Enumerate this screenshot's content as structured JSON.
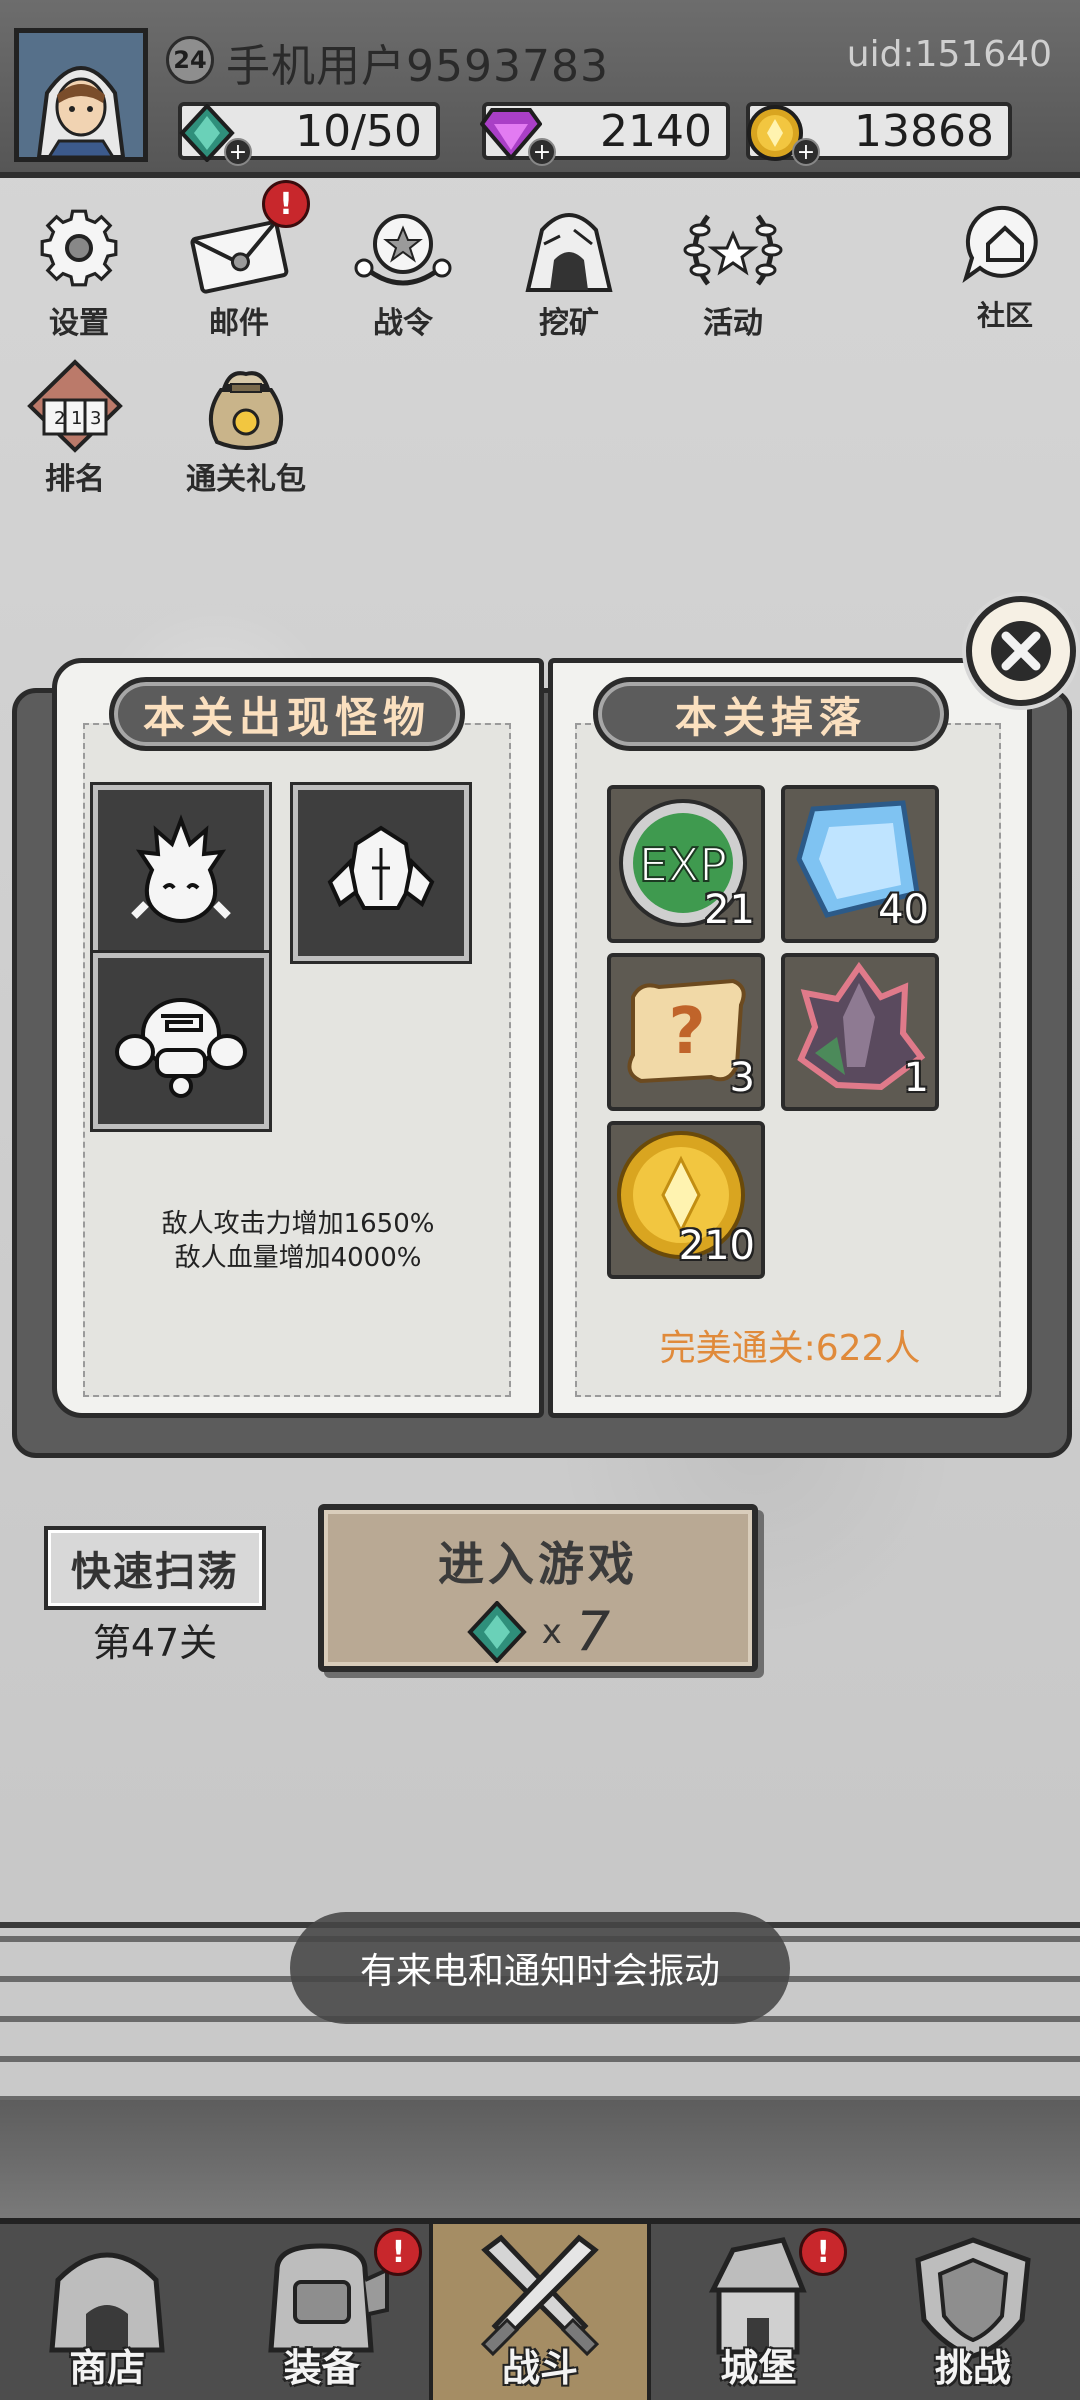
{
  "header": {
    "level": "24",
    "username": "手机用户9593783",
    "uid": "uid:151640",
    "stamina": "10/50",
    "gems": "2140",
    "coins": "13868",
    "icons": [
      "avatar-hooded-hero",
      "energy-crystal-icon",
      "purple-diamond-icon",
      "gold-coin-icon"
    ]
  },
  "menu": {
    "settings": "设置",
    "mail": "邮件",
    "battle_pass": "战令",
    "mining": "挖矿",
    "events": "活动",
    "community": "社区",
    "ranking": "排名",
    "clear_gift": "通关礼包",
    "notif_mark": "!"
  },
  "book": {
    "monsters_title": "本关出现怪物",
    "drops_title": "本关掉落",
    "monsters": [
      "flame-blob",
      "crystal-golem",
      "armored-beast"
    ],
    "buff_attack": "敌人攻击力增加1650%",
    "buff_hp": "敌人血量增加4000%",
    "drops": [
      {
        "item": "exp",
        "label": "EXP",
        "qty": "21"
      },
      {
        "item": "blue-gem",
        "qty": "40"
      },
      {
        "item": "mystery-scroll",
        "qty": "3"
      },
      {
        "item": "dark-crystal",
        "qty": "1"
      },
      {
        "item": "gold-coin",
        "qty": "210"
      }
    ],
    "perfect_clear": "完美通关:622人"
  },
  "actions": {
    "sweep": "快速扫荡",
    "stage": "第47关",
    "enter": "进入游戏",
    "cost_x": "x",
    "cost": "7"
  },
  "toast": "有来电和通知时会振动",
  "nav": [
    {
      "label": "商店"
    },
    {
      "label": "装备"
    },
    {
      "label": "战斗"
    },
    {
      "label": "城堡"
    },
    {
      "label": "挑战"
    }
  ],
  "colors": {
    "accent_orange": "#e08a3a",
    "notif_red": "#c8272c",
    "active_tab": "#a58d64"
  }
}
